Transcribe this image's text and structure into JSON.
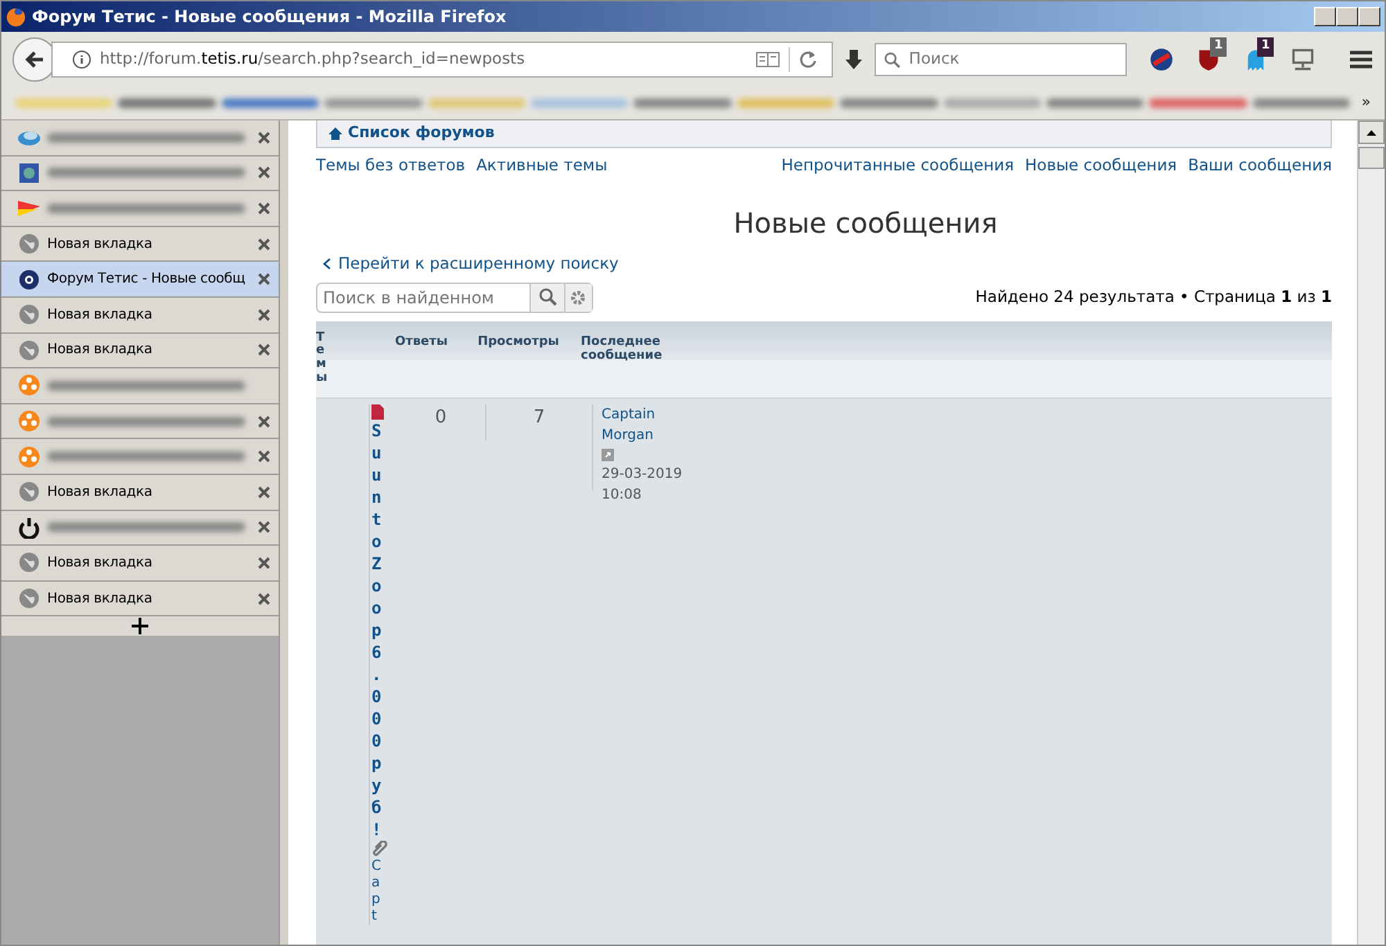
{
  "window": {
    "title": "Форум Тетис - Новые сообщения - Mozilla Firefox"
  },
  "toolbar": {
    "url": {
      "before": "http://forum.",
      "domain": "tetis.ru",
      "after": "/search.php?search_id=newposts"
    },
    "search": {
      "placeholder": "Поиск"
    },
    "extensions": [
      {
        "kind": "sn"
      },
      {
        "kind": "shield",
        "badge": "1"
      },
      {
        "kind": "ghost",
        "badge": "1"
      },
      {
        "kind": "monitor"
      }
    ]
  },
  "bookmarks": {
    "overflow": "»"
  },
  "tabs": [
    {
      "kind": "cloud",
      "selected": false,
      "close": true
    },
    {
      "kind": "square",
      "selected": false,
      "close": true
    },
    {
      "kind": "flag",
      "selected": false,
      "close": true
    },
    {
      "kind": "globe",
      "title": "Новая вкладка",
      "selected": false,
      "close": true
    },
    {
      "kind": "forum",
      "title": "Форум Тетис - Новые сообщ",
      "selected": true,
      "close": true
    },
    {
      "kind": "globe",
      "title": "Новая вкладка",
      "selected": false,
      "close": true
    },
    {
      "kind": "globe",
      "title": "Новая вкладка",
      "selected": false,
      "close": true
    },
    {
      "kind": "reel",
      "selected": false,
      "close": false
    },
    {
      "kind": "reel",
      "selected": false,
      "close": true
    },
    {
      "kind": "reel",
      "selected": false,
      "close": true
    },
    {
      "kind": "globe",
      "title": "Новая вкладка",
      "selected": false,
      "close": true
    },
    {
      "kind": "power",
      "selected": false,
      "close": true
    },
    {
      "kind": "globe",
      "title": "Новая вкладка",
      "selected": false,
      "close": true
    },
    {
      "kind": "globe",
      "title": "Новая вкладка",
      "selected": false,
      "close": true
    }
  ],
  "forum": {
    "breadcrumb": "Список форумов",
    "links_left": [
      "Темы без ответов",
      "Активные темы"
    ],
    "links_right": [
      "Непрочитанные сообщения",
      "Новые сообщения",
      "Ваши сообщения"
    ],
    "heading": "Новые сообщения",
    "back_link": "Перейти к расширенному поиску",
    "search": {
      "placeholder": "Поиск в найденном"
    },
    "results": "Найдено 24 результата • Страница **1** из **1**",
    "table": {
      "columns": [
        "Темы",
        "Ответы",
        "Просмотры",
        "Последнее сообщение"
      ],
      "rows": [
        {
          "title": "Suunto Zoop 6.000 руб!",
          "author": "Capt",
          "replies": "0",
          "views": "7",
          "last_author": "Captain Morgan",
          "last_time": "29-03-2019 10:08"
        }
      ]
    }
  }
}
